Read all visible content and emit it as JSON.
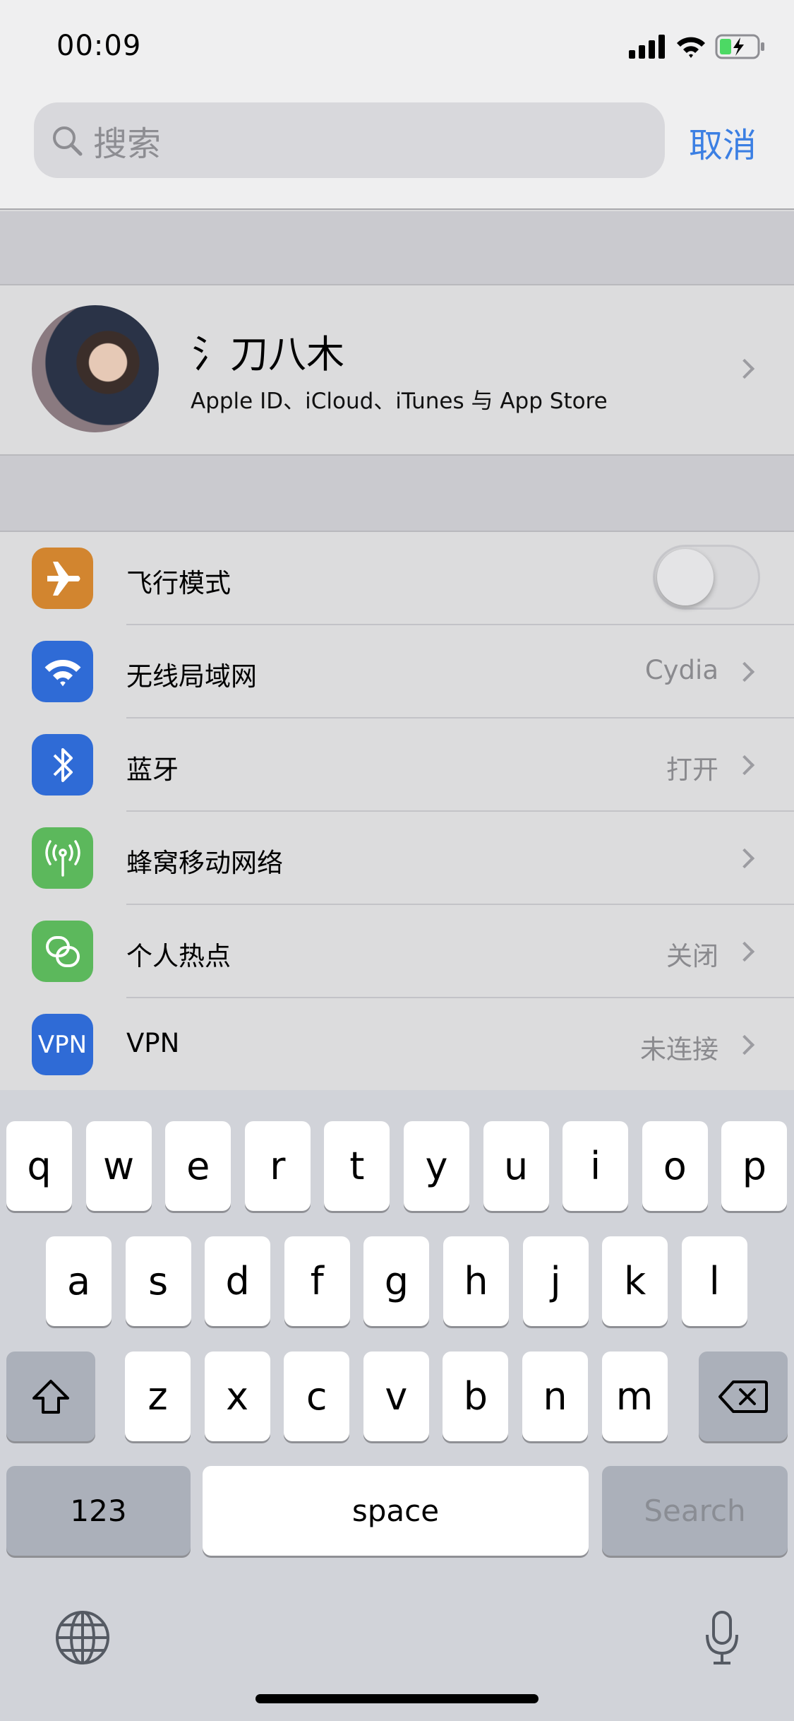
{
  "status": {
    "time": "00:09",
    "battery_color": "#4cd964"
  },
  "search": {
    "placeholder": "搜索",
    "cancel": "取消",
    "icon": "search-icon"
  },
  "profile": {
    "name": "氵刀八木",
    "subtitle": "Apple ID、iCloud、iTunes 与 App Store"
  },
  "settings": [
    {
      "label": "飞行模式",
      "icon": "airplane-icon",
      "color": "#d2852f",
      "toggle": false
    },
    {
      "label": "无线局域网",
      "value": "Cydia",
      "icon": "wifi-icon",
      "color": "#2f6bd6"
    },
    {
      "label": "蓝牙",
      "value": "打开",
      "icon": "bluetooth-icon",
      "color": "#2f6bd6"
    },
    {
      "label": "蜂窝移动网络",
      "value": "",
      "icon": "antenna-icon",
      "color": "#5cb85c"
    },
    {
      "label": "个人热点",
      "value": "关闭",
      "icon": "hotspot-icon",
      "color": "#5cb85c"
    },
    {
      "label": "VPN",
      "value": "未连接",
      "icon": "vpn-icon",
      "icon_text": "VPN",
      "color": "#2f6bd6"
    }
  ],
  "keyboard": {
    "row1": [
      "q",
      "w",
      "e",
      "r",
      "t",
      "y",
      "u",
      "i",
      "o",
      "p"
    ],
    "row2": [
      "a",
      "s",
      "d",
      "f",
      "g",
      "h",
      "j",
      "k",
      "l"
    ],
    "row3": [
      "z",
      "x",
      "c",
      "v",
      "b",
      "n",
      "m"
    ],
    "numbers": "123",
    "space": "space",
    "search": "Search"
  }
}
